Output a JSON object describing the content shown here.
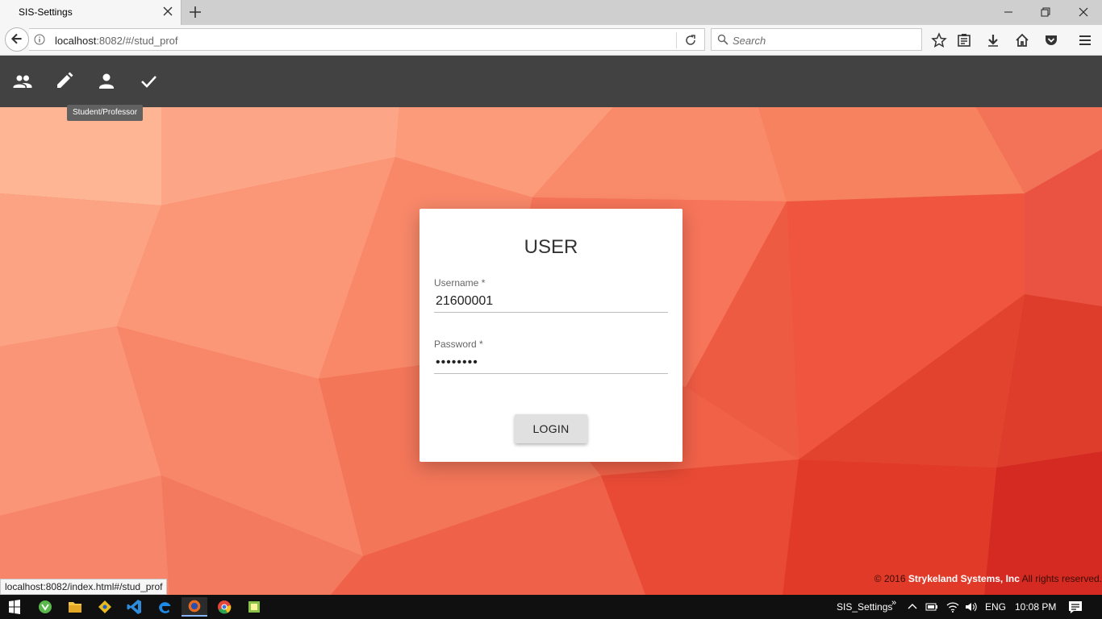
{
  "browser": {
    "tab_title": "SIS-Settings",
    "url_host": "localhost",
    "url_rest": ":8082/#/stud_prof",
    "search_placeholder": "Search",
    "status_url": "localhost:8082/index.html#/stud_prof"
  },
  "app": {
    "toolbar": {
      "icons": [
        "people-icon",
        "edit-icon",
        "person-icon",
        "check-icon"
      ],
      "tooltip": "Student/Professor"
    },
    "login": {
      "heading": "USER",
      "username_label": "Username *",
      "username_value": "21600001",
      "password_label": "Password *",
      "password_value": "••••••••",
      "button": "LOGIN"
    },
    "footer": {
      "year": "© 2016",
      "company": "Strykeland Systems, Inc",
      "rights": "All rights reserved."
    },
    "colors": {
      "toolbar": "#424242",
      "background": "#f06a4d"
    }
  },
  "taskbar": {
    "app_label": "SIS_Settings",
    "language": "ENG",
    "time": "10:08 PM"
  }
}
